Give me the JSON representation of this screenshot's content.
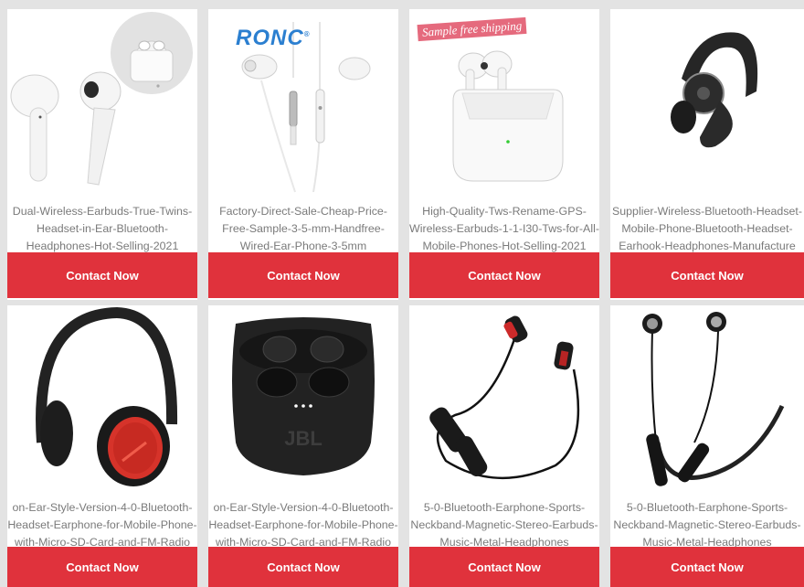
{
  "cta_label": "Contact Now",
  "products": [
    {
      "lines": [
        "Dual-Wireless-Earbuds-True-Twins-",
        "Headset-in-Ear-Bluetooth-",
        "Headphones-Hot-Selling-2021"
      ],
      "image": "white-wireless-earbuds-with-case"
    },
    {
      "lines": [
        "Factory-Direct-Sale-Cheap-Price-",
        "Free-Sample-3-5-mm-Handfree-",
        "Wired-Ear-Phone-3-5mm"
      ],
      "image": "white-wired-earphones",
      "brand": "RONC",
      "brand_mark": "®"
    },
    {
      "lines": [
        "High-Quality-Tws-Rename-GPS-",
        "Wireless-Earbuds-1-1-I30-Tws-for-All-",
        "Mobile-Phones-Hot-Selling-2021"
      ],
      "image": "white-earbuds-in-charging-case",
      "tag": "Sample free shipping"
    },
    {
      "lines": [
        "Supplier-Wireless-Bluetooth-Headset-",
        "Mobile-Phone-Bluetooth-Headset-",
        "Earhook-Headphones-Manufacture"
      ],
      "image": "black-earhook-headset"
    },
    {
      "lines": [
        "on-Ear-Style-Version-4-0-Bluetooth-",
        "Headset-Earphone-for-Mobile-Phone-",
        "with-Micro-SD-Card-and-FM-Radio"
      ],
      "image": "black-red-over-ear-headphones"
    },
    {
      "lines": [
        "on-Ear-Style-Version-4-0-Bluetooth-",
        "Headset-Earphone-for-Mobile-Phone-",
        "with-Micro-SD-Card-and-FM-Radio"
      ],
      "image": "black-earbuds-in-case",
      "case_logo": "JBL"
    },
    {
      "lines": [
        "5-0-Bluetooth-Earphone-Sports-",
        "Neckband-Magnetic-Stereo-Earbuds-",
        "Music-Metal-Headphones"
      ],
      "image": "black-red-neckband-earphones"
    },
    {
      "lines": [
        "5-0-Bluetooth-Earphone-Sports-",
        "Neckband-Magnetic-Stereo-Earbuds-",
        "Music-Metal-Headphones"
      ],
      "image": "black-silver-neckband-earphones"
    }
  ]
}
